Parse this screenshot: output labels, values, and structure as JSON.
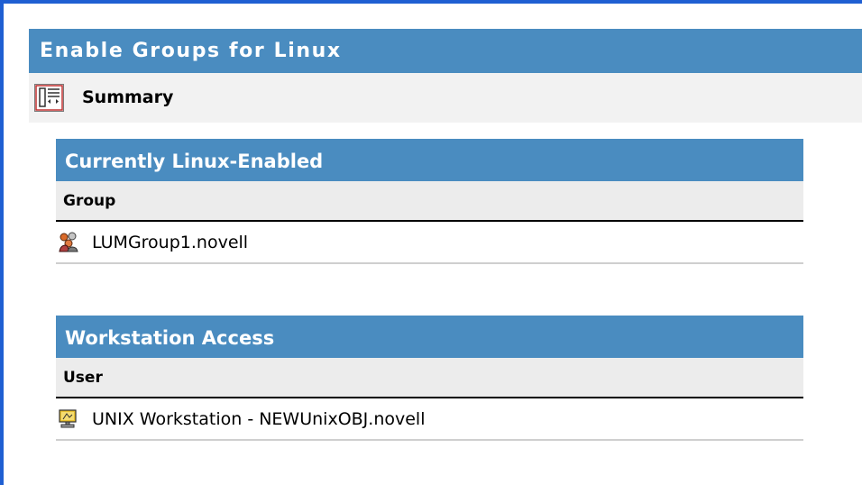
{
  "page": {
    "title": "Enable Groups for Linux",
    "summary_label": "Summary",
    "summary_icon": "summary-icon"
  },
  "sections": [
    {
      "title": "Currently Linux-Enabled",
      "column_header": "Group",
      "rows": [
        {
          "label": "LUMGroup1.novell",
          "icon": "group-icon"
        }
      ]
    },
    {
      "title": "Workstation Access",
      "column_header": "User",
      "rows": [
        {
          "label": "UNIX Workstation - NEWUnixOBJ.novell",
          "icon": "workstation-icon"
        }
      ]
    }
  ],
  "colors": {
    "frame": "#1f5fd2",
    "header_blue": "#4a8cc0",
    "summary_bg": "#f2f2f2",
    "column_header_bg": "#ececec"
  }
}
